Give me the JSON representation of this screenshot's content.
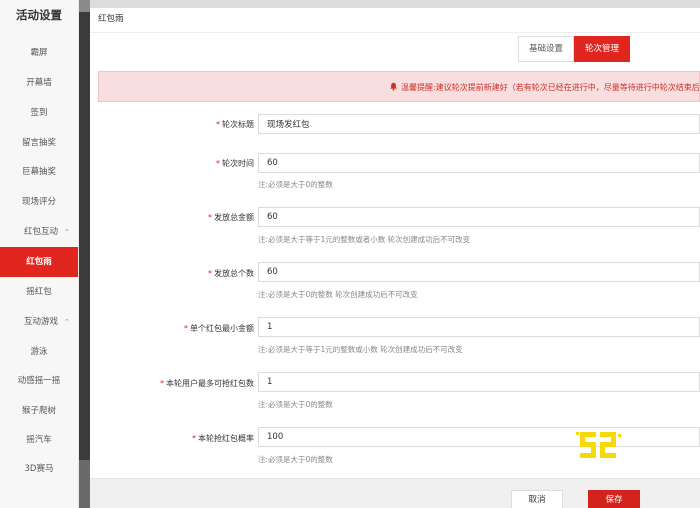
{
  "sidebar": {
    "title": "活动设置",
    "items": [
      {
        "label": "霸屏"
      },
      {
        "label": "开幕墙"
      },
      {
        "label": "签到"
      },
      {
        "label": "留言抽奖"
      },
      {
        "label": "巨幕抽奖"
      },
      {
        "label": "现场评分"
      }
    ],
    "group_hongbao": {
      "label": "红包互动"
    },
    "hongbao_items": [
      {
        "label": "红包雨",
        "active": true
      },
      {
        "label": "摇红包"
      }
    ],
    "group_games": {
      "label": "互动游戏"
    },
    "game_items": [
      {
        "label": "游泳"
      },
      {
        "label": "动感摇一摇"
      },
      {
        "label": "猴子爬树"
      },
      {
        "label": "摇汽车"
      },
      {
        "label": "3D赛马"
      }
    ]
  },
  "panel": {
    "title": "红包雨",
    "tabs": [
      {
        "label": "基础设置",
        "active": false
      },
      {
        "label": "轮次管理",
        "active": true
      }
    ],
    "notice": "温馨提醒:建议轮次提前新建好（若有轮次已经在进行中，尽量等待进行中轮次结束后再创建）"
  },
  "form": {
    "fields": [
      {
        "label": "轮次标题",
        "required": true,
        "value": "现场发红包",
        "hint": ""
      },
      {
        "label": "轮次时间",
        "required": true,
        "value": "60",
        "hint": "注:必须是大于0的整数"
      },
      {
        "label": "发放总金额",
        "required": true,
        "value": "60",
        "hint": "注:必须是大于等于1元的整数或者小数 轮次创建成功后不可改变"
      },
      {
        "label": "发放总个数",
        "required": true,
        "value": "60",
        "hint": "注:必须是大于0的整数 轮次创建成功后不可改变"
      },
      {
        "label": "单个红包最小金额",
        "required": true,
        "value": "1",
        "hint": "注:必须是大于等于1元的整数或小数 轮次创建成功后不可改变"
      },
      {
        "label": "本轮用户最多可抢红包数",
        "required": true,
        "value": "1",
        "hint": "注:必须是大于0的整数"
      },
      {
        "label": "本轮抢红包概率",
        "required": true,
        "value": "100",
        "hint": "注:必须是大于0的整数"
      }
    ]
  },
  "footer": {
    "cancel_label": "取消",
    "save_label": "保存"
  },
  "colors": {
    "accent": "#e0261f",
    "notice_bg": "#f8dede",
    "notice_text": "#d0312a",
    "logo": "#f5d90a"
  },
  "icons": {
    "notice": "bell-icon",
    "group_toggle": "chevron-icon"
  }
}
